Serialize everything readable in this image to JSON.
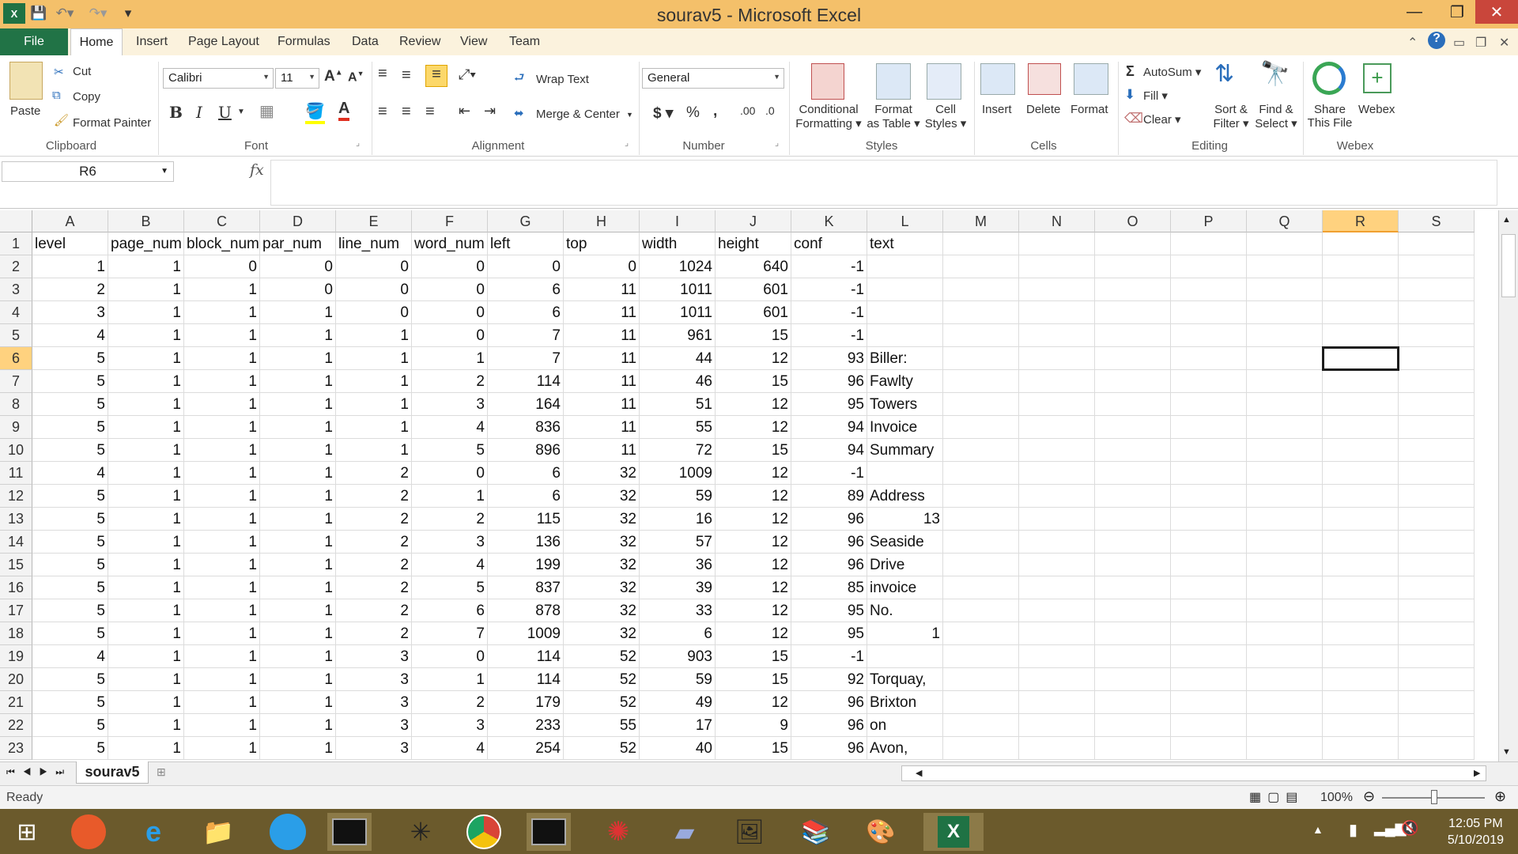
{
  "window": {
    "title": "sourav5 - Microsoft Excel"
  },
  "tabs": [
    "File",
    "Home",
    "Insert",
    "Page Layout",
    "Formulas",
    "Data",
    "Review",
    "View",
    "Team"
  ],
  "ribbon": {
    "clipboard": {
      "paste": "Paste",
      "cut": "Cut",
      "copy": "Copy",
      "format_painter": "Format Painter",
      "label": "Clipboard"
    },
    "font": {
      "name": "Calibri",
      "size": "11",
      "label": "Font"
    },
    "alignment": {
      "wrap_text": "Wrap Text",
      "merge_center": "Merge & Center",
      "label": "Alignment"
    },
    "number": {
      "format": "General",
      "label": "Number"
    },
    "styles": {
      "conditional_1": "Conditional",
      "conditional_2": "Formatting",
      "table_1": "Format",
      "table_2": "as Table",
      "cell_1": "Cell",
      "cell_2": "Styles",
      "label": "Styles"
    },
    "cells": {
      "insert": "Insert",
      "delete": "Delete",
      "format": "Format",
      "label": "Cells"
    },
    "editing": {
      "autosum": "AutoSum",
      "fill": "Fill",
      "clear": "Clear",
      "sort_1": "Sort &",
      "sort_2": "Filter",
      "find_1": "Find &",
      "find_2": "Select",
      "label": "Editing"
    },
    "webex": {
      "share_1": "Share",
      "share_2": "This File",
      "webex": "Webex",
      "label": "Webex"
    }
  },
  "formula_bar": {
    "name_box": "R6",
    "fx": "fx",
    "formula": ""
  },
  "columns": [
    "A",
    "B",
    "C",
    "D",
    "E",
    "F",
    "G",
    "H",
    "I",
    "J",
    "K",
    "L",
    "M",
    "N",
    "O",
    "P",
    "Q",
    "R",
    "S"
  ],
  "rows": [
    [
      "level",
      "page_num",
      "block_num",
      "par_num",
      "line_num",
      "word_num",
      "left",
      "top",
      "width",
      "height",
      "conf",
      "text"
    ],
    [
      "1",
      "1",
      "0",
      "0",
      "0",
      "0",
      "0",
      "0",
      "1024",
      "640",
      "-1",
      ""
    ],
    [
      "2",
      "1",
      "1",
      "0",
      "0",
      "0",
      "6",
      "11",
      "1011",
      "601",
      "-1",
      ""
    ],
    [
      "3",
      "1",
      "1",
      "1",
      "0",
      "0",
      "6",
      "11",
      "1011",
      "601",
      "-1",
      ""
    ],
    [
      "4",
      "1",
      "1",
      "1",
      "1",
      "0",
      "7",
      "11",
      "961",
      "15",
      "-1",
      ""
    ],
    [
      "5",
      "1",
      "1",
      "1",
      "1",
      "1",
      "7",
      "11",
      "44",
      "12",
      "93",
      "Biller:"
    ],
    [
      "5",
      "1",
      "1",
      "1",
      "1",
      "2",
      "114",
      "11",
      "46",
      "15",
      "96",
      "Fawlty"
    ],
    [
      "5",
      "1",
      "1",
      "1",
      "1",
      "3",
      "164",
      "11",
      "51",
      "12",
      "95",
      "Towers"
    ],
    [
      "5",
      "1",
      "1",
      "1",
      "1",
      "4",
      "836",
      "11",
      "55",
      "12",
      "94",
      "Invoice"
    ],
    [
      "5",
      "1",
      "1",
      "1",
      "1",
      "5",
      "896",
      "11",
      "72",
      "15",
      "94",
      "Summary"
    ],
    [
      "4",
      "1",
      "1",
      "1",
      "2",
      "0",
      "6",
      "32",
      "1009",
      "12",
      "-1",
      ""
    ],
    [
      "5",
      "1",
      "1",
      "1",
      "2",
      "1",
      "6",
      "32",
      "59",
      "12",
      "89",
      "Address"
    ],
    [
      "5",
      "1",
      "1",
      "1",
      "2",
      "2",
      "115",
      "32",
      "16",
      "12",
      "96",
      "13"
    ],
    [
      "5",
      "1",
      "1",
      "1",
      "2",
      "3",
      "136",
      "32",
      "57",
      "12",
      "96",
      "Seaside"
    ],
    [
      "5",
      "1",
      "1",
      "1",
      "2",
      "4",
      "199",
      "32",
      "36",
      "12",
      "96",
      "Drive"
    ],
    [
      "5",
      "1",
      "1",
      "1",
      "2",
      "5",
      "837",
      "32",
      "39",
      "12",
      "85",
      "invoice"
    ],
    [
      "5",
      "1",
      "1",
      "1",
      "2",
      "6",
      "878",
      "32",
      "33",
      "12",
      "95",
      "No."
    ],
    [
      "5",
      "1",
      "1",
      "1",
      "2",
      "7",
      "1009",
      "32",
      "6",
      "12",
      "95",
      "1"
    ],
    [
      "4",
      "1",
      "1",
      "1",
      "3",
      "0",
      "114",
      "52",
      "903",
      "15",
      "-1",
      ""
    ],
    [
      "5",
      "1",
      "1",
      "1",
      "3",
      "1",
      "114",
      "52",
      "59",
      "15",
      "92",
      "Torquay,"
    ],
    [
      "5",
      "1",
      "1",
      "1",
      "3",
      "2",
      "179",
      "52",
      "49",
      "12",
      "96",
      "Brixton"
    ],
    [
      "5",
      "1",
      "1",
      "1",
      "3",
      "3",
      "233",
      "55",
      "17",
      "9",
      "96",
      "on"
    ],
    [
      "5",
      "1",
      "1",
      "1",
      "3",
      "4",
      "254",
      "52",
      "40",
      "15",
      "96",
      "Avon,"
    ]
  ],
  "selected_cell": {
    "column": "R",
    "row": 6
  },
  "sheet_tab": "sourav5",
  "status": {
    "ready": "Ready",
    "zoom": "100%"
  },
  "clock": {
    "time": "12:05 PM",
    "date": "5/10/2019"
  }
}
